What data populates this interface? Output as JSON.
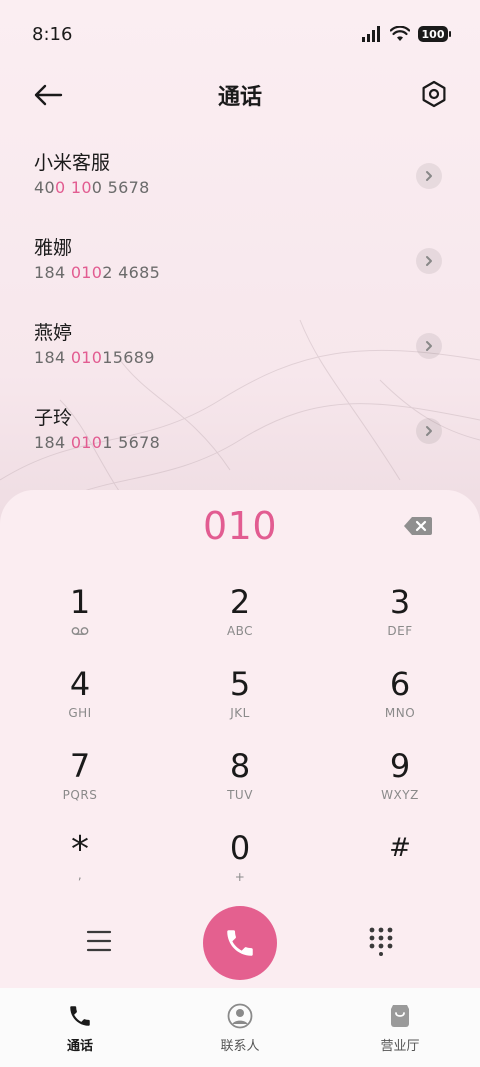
{
  "status_bar": {
    "time": "8:16",
    "battery": "100"
  },
  "header": {
    "title": "通话"
  },
  "contacts": [
    {
      "name": "小米客服",
      "number_parts": [
        "40",
        "0 10",
        "0 5678"
      ]
    },
    {
      "name": "雅娜",
      "number_parts": [
        "184 ",
        "010",
        "2 4685"
      ]
    },
    {
      "name": "燕婷",
      "number_parts": [
        "184 ",
        "010",
        "15689"
      ]
    },
    {
      "name": "子玲",
      "number_parts": [
        "184 ",
        "010",
        "1 5678"
      ]
    }
  ],
  "dialer": {
    "dialed": "010",
    "keys": [
      [
        {
          "digit": "1",
          "letters": ""
        },
        {
          "digit": "2",
          "letters": "ABC"
        },
        {
          "digit": "3",
          "letters": "DEF"
        }
      ],
      [
        {
          "digit": "4",
          "letters": "GHI"
        },
        {
          "digit": "5",
          "letters": "JKL"
        },
        {
          "digit": "6",
          "letters": "MNO"
        }
      ],
      [
        {
          "digit": "7",
          "letters": "PQRS"
        },
        {
          "digit": "8",
          "letters": "TUV"
        },
        {
          "digit": "9",
          "letters": "WXYZ"
        }
      ],
      [
        {
          "digit": "*",
          "letters": ","
        },
        {
          "digit": "0",
          "letters": "+"
        },
        {
          "digit": "#",
          "letters": ""
        }
      ]
    ]
  },
  "bottom_nav": [
    {
      "label": "通话",
      "icon": "phone-icon",
      "active": true
    },
    {
      "label": "联系人",
      "icon": "person-icon",
      "active": false
    },
    {
      "label": "营业厅",
      "icon": "shopping-bag-icon",
      "active": false
    }
  ],
  "colors": {
    "accent": "#e25c91",
    "call_button": "#e4608f"
  }
}
